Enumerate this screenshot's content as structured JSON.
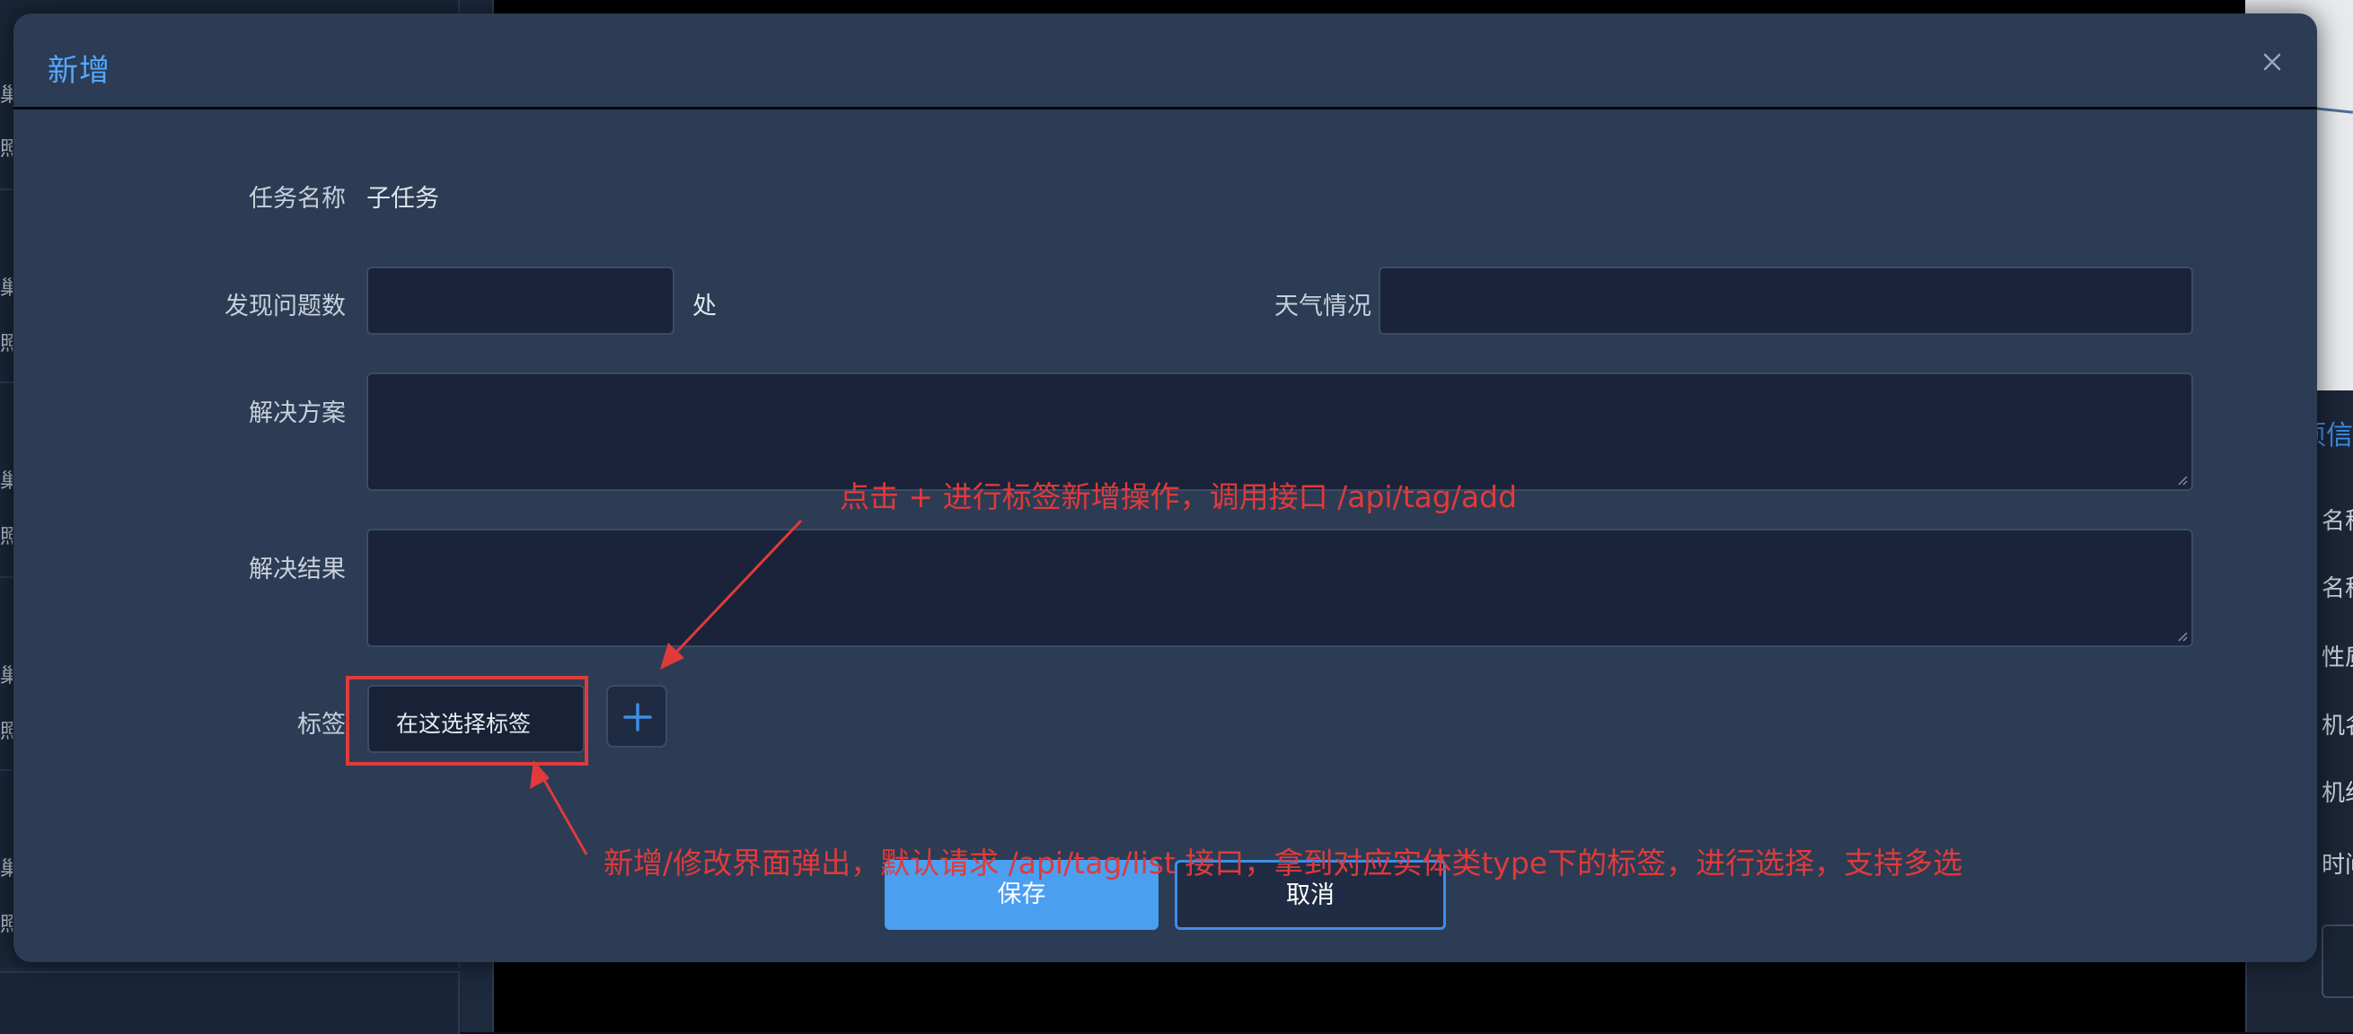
{
  "background": {
    "left_rows": [
      "巢",
      "照",
      "巢",
      "照",
      "巢",
      "照",
      "巢",
      "照",
      "巢",
      "照"
    ],
    "right_header": "项信",
    "right_items": [
      "名称",
      "名称",
      "性质",
      "机名",
      "机组",
      "时间"
    ]
  },
  "modal": {
    "title": "新增",
    "close_label": "×",
    "fields": {
      "task_name": {
        "label": "任务名称",
        "value": "子任务"
      },
      "issue_count": {
        "label": "发现问题数",
        "value": "",
        "unit": "处"
      },
      "weather": {
        "label": "天气情况",
        "value": ""
      },
      "solution": {
        "label": "解决方案",
        "value": ""
      },
      "result": {
        "label": "解决结果",
        "value": ""
      },
      "tag": {
        "label": "标签",
        "placeholder": "在这选择标签",
        "add_label": "+"
      }
    },
    "buttons": {
      "save": "保存",
      "cancel": "取消"
    }
  },
  "annotations": {
    "add_tag_note": "点击 + 进行标签新增操作，调用接口 /api/tag/add",
    "list_tag_note": "新增/修改界面弹出，默认请求 /api/tag/list 接口，拿到对应实体类type下的标签，进行选择，支持多选",
    "color": "#e03a3a"
  },
  "colors": {
    "accent": "#55a7ff",
    "modal_bg": "#2b3c54",
    "input_bg": "#1a2339",
    "save_button": "#4a9ff1"
  }
}
